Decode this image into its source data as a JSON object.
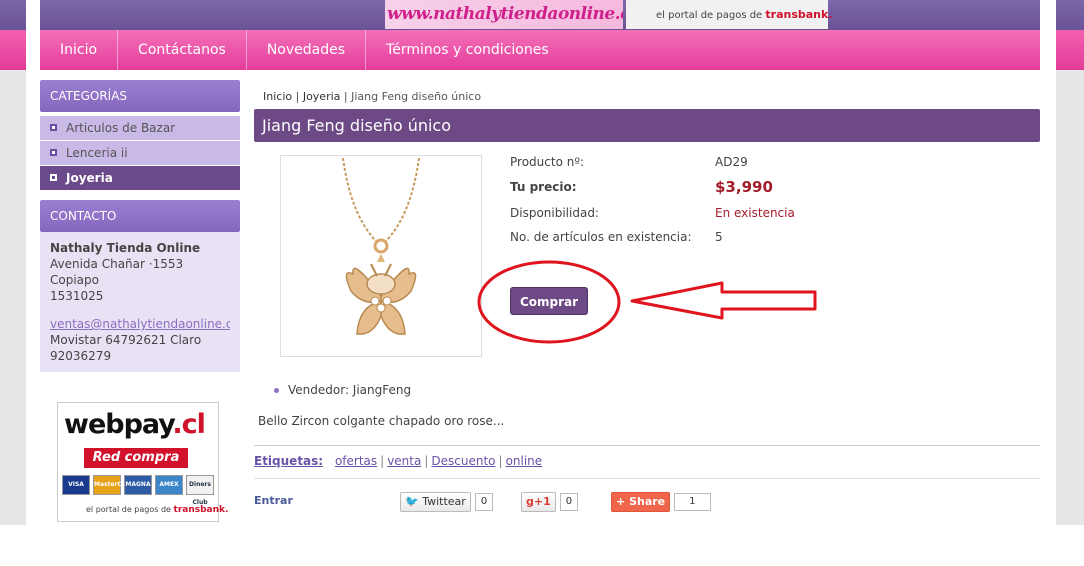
{
  "header": {
    "banner_text": "www.nathalytiendaonline.cl",
    "payment_text": "el portal de pagos de",
    "payment_brand": "transbank."
  },
  "nav": {
    "items": [
      "Inicio",
      "Contáctanos",
      "Novedades",
      "Términos y condiciones"
    ]
  },
  "sidebar": {
    "categories_title": "CATEGORÍAS",
    "categories": [
      "Articulos de Bazar",
      "Lenceria ii",
      "Joyeria"
    ],
    "active_category": "Joyeria",
    "contact_title": "CONTACTO",
    "contact": {
      "name": "Nathaly Tienda Online",
      "address": "Avenida Chañar ·1553",
      "city": "Copiapo",
      "zip": "1531025",
      "email": "ventas@nathalytiendaonline.cl",
      "phone": "Movistar 64792621 Claro 92036279"
    },
    "webpay": {
      "logo_main": "webpay",
      "logo_suffix": ".cl",
      "redcompra": "Red compra",
      "cards": [
        "VISA",
        "MasterCard",
        "MAGNA",
        "AMEX",
        "Diners Club"
      ],
      "footer_text": "el portal de pagos de",
      "footer_brand": "transbank."
    }
  },
  "breadcrumb": {
    "items": [
      "Inicio",
      "Joyeria",
      "Jiang Feng diseño único"
    ],
    "separator": "|"
  },
  "product": {
    "title": "Jiang Feng diseño único",
    "code_label": "Producto nº:",
    "code": "AD29",
    "price_label": "Tu precio:",
    "price": "$3,990",
    "availability_label": "Disponibilidad:",
    "availability": "En existencia",
    "stock_label": "No. de artículos en existencia:",
    "stock": "5",
    "buy_label": "Comprar",
    "vendor": "Vendedor: JiangFeng",
    "description": "Bello Zircon colgante chapado oro rose..."
  },
  "tags": {
    "label": "Etiquetas",
    "items": [
      "ofertas",
      "venta",
      "Descuento",
      "online"
    ]
  },
  "social": {
    "entrar": "Entrar",
    "twitter_label": "Twittear",
    "twitter_count": "0",
    "gplus_label": "+1",
    "gplus_count": "0",
    "share_label": "Share",
    "share_count": "1"
  },
  "colors": {
    "accent_purple": "#6d4a85",
    "nav_pink": "#e43d9c",
    "price_red": "#a31d2a",
    "annotation_red": "#e0141e"
  }
}
